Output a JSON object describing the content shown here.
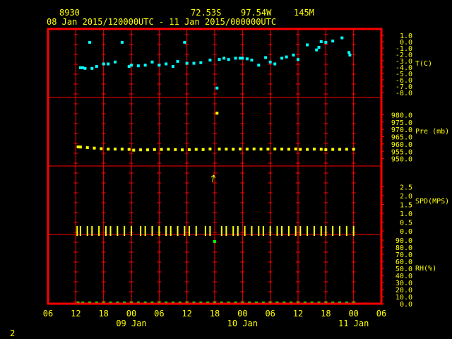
{
  "header": {
    "station": "8930",
    "lat": "72.53S",
    "lon": "97.54W",
    "elev": "145M",
    "period": "08 Jan 2015/120000UTC - 11 Jan 2015/000000UTC"
  },
  "page_number": "2",
  "colors": {
    "background": "#000000",
    "frame": "#ff0000",
    "grid": "#ff0000",
    "text": "#ffff00",
    "temperature": "#00ffff",
    "pressure": "#ffff00",
    "wind": "#ffff00",
    "humidity": "#00ff00"
  },
  "chart_data": {
    "type": "scatter",
    "x_axis": {
      "ticks": [
        "06",
        "12",
        "18",
        "00",
        "06",
        "12",
        "18",
        "00",
        "06",
        "12",
        "18",
        "00",
        "06"
      ],
      "day_labels": [
        {
          "label": "09 Jan",
          "tick_index": 3
        },
        {
          "label": "10 Jan",
          "tick_index": 7
        },
        {
          "label": "11 Jan",
          "tick_index": 11
        }
      ],
      "range_hours": [
        -6,
        66
      ]
    },
    "panels": [
      {
        "name": "T(C)",
        "ylim": [
          -8.0,
          1.0
        ],
        "ticks": [
          "1.0",
          "0.0",
          "-1.0",
          "-2.0",
          "-3.0",
          "-4.0",
          "-5.0",
          "-6.0",
          "-7.0",
          "-8.0"
        ],
        "points": [
          [
            1.0,
            -4.1
          ],
          [
            1.5,
            -4.1
          ],
          [
            2.0,
            -4.2
          ],
          [
            3.0,
            -0.1
          ],
          [
            3.5,
            -4.2
          ],
          [
            4.5,
            -3.9
          ],
          [
            6.0,
            -3.5
          ],
          [
            7.0,
            -3.5
          ],
          [
            8.5,
            -3.2
          ],
          [
            10.0,
            -0.1
          ],
          [
            11.5,
            -3.9
          ],
          [
            12.0,
            -3.7
          ],
          [
            13.5,
            -3.8
          ],
          [
            15.0,
            -3.7
          ],
          [
            16.5,
            -3.2
          ],
          [
            18.0,
            -3.7
          ],
          [
            19.5,
            -3.5
          ],
          [
            21.0,
            -3.9
          ],
          [
            22.0,
            -3.1
          ],
          [
            23.5,
            -0.1
          ],
          [
            24.0,
            -3.4
          ],
          [
            25.5,
            -3.4
          ],
          [
            27.0,
            -3.3
          ],
          [
            29.0,
            -2.9
          ],
          [
            30.5,
            -7.3
          ],
          [
            31.0,
            -2.8
          ],
          [
            32.0,
            -2.6
          ],
          [
            33.0,
            -2.8
          ],
          [
            34.5,
            -2.6
          ],
          [
            35.5,
            -2.6
          ],
          [
            36.0,
            -2.6
          ],
          [
            37.0,
            -2.7
          ],
          [
            38.0,
            -2.9
          ],
          [
            39.5,
            -3.7
          ],
          [
            41.0,
            -2.5
          ],
          [
            42.0,
            -3.2
          ],
          [
            43.0,
            -3.5
          ],
          [
            44.5,
            -2.6
          ],
          [
            45.5,
            -2.4
          ],
          [
            47.0,
            -2.1
          ],
          [
            48.0,
            -2.8
          ],
          [
            50.0,
            -0.5
          ],
          [
            52.0,
            -1.3
          ],
          [
            52.5,
            -0.9
          ],
          [
            53.0,
            0.0
          ],
          [
            54.0,
            -0.1
          ],
          [
            55.5,
            0.1
          ],
          [
            57.5,
            0.6
          ],
          [
            59.0,
            -1.7
          ],
          [
            59.2,
            -2.1
          ]
        ]
      },
      {
        "name": "Pre (mb)",
        "ylim": [
          945.0,
          985.0
        ],
        "ticks": [
          "980.0",
          "975.0",
          "970.0",
          "965.0",
          "960.0",
          "955.0",
          "950.0"
        ],
        "points": [
          [
            0.5,
            958.0
          ],
          [
            1.0,
            957.9
          ],
          [
            2.5,
            957.5
          ],
          [
            4.0,
            957.2
          ],
          [
            5.5,
            956.8
          ],
          [
            7.0,
            956.5
          ],
          [
            8.5,
            956.5
          ],
          [
            10.0,
            956.5
          ],
          [
            11.5,
            956.3
          ],
          [
            12.5,
            955.8
          ],
          [
            14.0,
            956.0
          ],
          [
            15.5,
            956.0
          ],
          [
            17.0,
            956.2
          ],
          [
            18.5,
            956.3
          ],
          [
            20.0,
            956.4
          ],
          [
            21.5,
            956.2
          ],
          [
            23.0,
            956.0
          ],
          [
            24.5,
            956.1
          ],
          [
            26.0,
            956.3
          ],
          [
            27.5,
            956.2
          ],
          [
            29.0,
            956.6
          ],
          [
            30.5,
            981.0
          ],
          [
            31.0,
            956.5
          ],
          [
            32.5,
            956.5
          ],
          [
            34.0,
            956.4
          ],
          [
            35.5,
            956.6
          ],
          [
            37.0,
            956.5
          ],
          [
            38.5,
            956.6
          ],
          [
            40.0,
            956.5
          ],
          [
            41.5,
            956.5
          ],
          [
            43.0,
            956.6
          ],
          [
            44.5,
            956.5
          ],
          [
            46.0,
            956.4
          ],
          [
            47.5,
            956.6
          ],
          [
            48.5,
            956.3
          ],
          [
            50.0,
            956.3
          ],
          [
            51.5,
            956.5
          ],
          [
            53.0,
            956.4
          ],
          [
            54.0,
            956.1
          ],
          [
            55.5,
            956.3
          ],
          [
            57.0,
            956.3
          ],
          [
            58.5,
            956.4
          ],
          [
            60.0,
            956.4
          ]
        ]
      },
      {
        "name": "SPD(MPS)",
        "ylim": [
          -0.2,
          3.0
        ],
        "ticks": [
          "2.5",
          "2.0",
          "1.5",
          "1.0",
          "0.5",
          "0.0"
        ],
        "points": [
          [
            0.3,
            0.0
          ],
          [
            1.0,
            0.0
          ],
          [
            2.5,
            0.0
          ],
          [
            3.5,
            0.0
          ],
          [
            5.0,
            0.0
          ],
          [
            6.5,
            0.0
          ],
          [
            7.5,
            0.0
          ],
          [
            9.0,
            0.0
          ],
          [
            10.5,
            0.0
          ],
          [
            12.0,
            0.0
          ],
          [
            14.0,
            0.0
          ],
          [
            15.0,
            0.0
          ],
          [
            16.5,
            0.0
          ],
          [
            18.0,
            0.0
          ],
          [
            19.5,
            0.0
          ],
          [
            20.5,
            0.0
          ],
          [
            22.0,
            0.0
          ],
          [
            23.5,
            0.0
          ],
          [
            24.5,
            0.0
          ],
          [
            26.0,
            0.0
          ],
          [
            28.0,
            0.0
          ],
          [
            29.0,
            0.0
          ],
          [
            31.5,
            0.0
          ],
          [
            32.5,
            0.0
          ],
          [
            34.0,
            0.0
          ],
          [
            35.0,
            0.0
          ],
          [
            36.5,
            0.0
          ],
          [
            38.0,
            0.0
          ],
          [
            39.5,
            0.0
          ],
          [
            40.5,
            0.0
          ],
          [
            42.0,
            0.0
          ],
          [
            43.5,
            0.0
          ],
          [
            44.5,
            0.0
          ],
          [
            46.0,
            0.0
          ],
          [
            47.5,
            0.0
          ],
          [
            48.5,
            0.0
          ],
          [
            50.0,
            0.0
          ],
          [
            51.5,
            0.0
          ],
          [
            53.0,
            0.0
          ],
          [
            54.0,
            0.0
          ],
          [
            55.5,
            0.0
          ],
          [
            57.0,
            0.0
          ],
          [
            58.5,
            0.0
          ],
          [
            60.0,
            0.0
          ]
        ],
        "arrows": [
          {
            "x": 29.5,
            "y": 2.9
          }
        ]
      },
      {
        "name": "RH(%)",
        "ylim": [
          0.0,
          90.0
        ],
        "ticks": [
          "90.0",
          "80.0",
          "70.0",
          "60.0",
          "50.0",
          "40.0",
          "30.0",
          "20.0",
          "10.0",
          "0.0"
        ],
        "points": [
          [
            30.0,
            88.0
          ],
          [
            0.5,
            0.0
          ],
          [
            1.5,
            0.0
          ],
          [
            3.0,
            0.0
          ],
          [
            4.5,
            0.0
          ],
          [
            6.0,
            0.0
          ],
          [
            7.5,
            0.0
          ],
          [
            9.0,
            0.0
          ],
          [
            10.5,
            0.0
          ],
          [
            12.0,
            0.0
          ],
          [
            13.5,
            0.0
          ],
          [
            15.0,
            0.0
          ],
          [
            16.5,
            0.0
          ],
          [
            18.0,
            0.0
          ],
          [
            19.5,
            0.0
          ],
          [
            21.0,
            0.0
          ],
          [
            22.5,
            0.0
          ],
          [
            24.0,
            0.0
          ],
          [
            25.5,
            0.0
          ],
          [
            27.0,
            0.0
          ],
          [
            28.5,
            0.0
          ],
          [
            30.0,
            0.0
          ],
          [
            31.5,
            0.0
          ],
          [
            33.0,
            0.0
          ],
          [
            34.5,
            0.0
          ],
          [
            36.0,
            0.0
          ],
          [
            37.5,
            0.0
          ],
          [
            39.0,
            0.0
          ],
          [
            40.5,
            0.0
          ],
          [
            42.0,
            0.0
          ],
          [
            43.5,
            0.0
          ],
          [
            45.0,
            0.0
          ],
          [
            46.5,
            0.0
          ],
          [
            48.0,
            0.0
          ],
          [
            49.5,
            0.0
          ],
          [
            51.0,
            0.0
          ],
          [
            52.5,
            0.0
          ],
          [
            54.0,
            0.0
          ],
          [
            55.5,
            0.0
          ],
          [
            57.0,
            0.0
          ],
          [
            58.5,
            0.0
          ],
          [
            60.0,
            0.0
          ]
        ]
      }
    ],
    "grid": true,
    "legend": "right"
  }
}
